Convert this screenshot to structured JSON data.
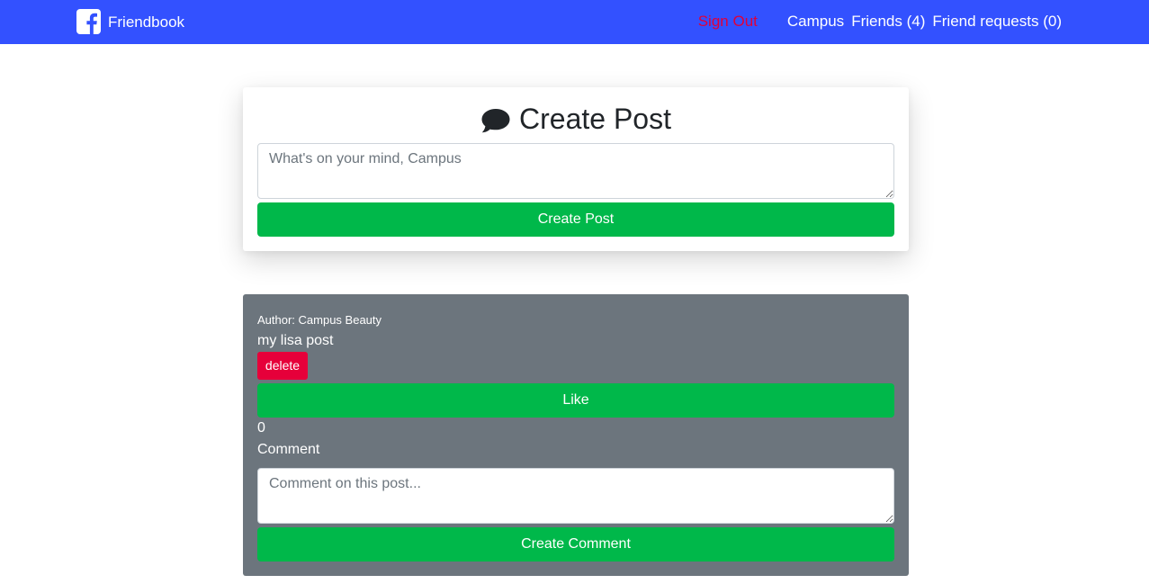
{
  "navbar": {
    "brand_icon": "facebook-logo-icon",
    "brand": "Friendbook",
    "background": "#3351ff",
    "sign_out": "Sign Out",
    "sign_out_color": "#e0003a",
    "user": "Campus",
    "friends": "Friends (4)",
    "friend_requests": "Friend requests (0)"
  },
  "create_post": {
    "icon": "comment-icon",
    "title": "Create Post",
    "placeholder": "What's on your mind, Campus",
    "button": "Create Post"
  },
  "post": {
    "author": "Author: Campus Beauty",
    "text": "my lisa post",
    "delete": "delete",
    "like": "Like",
    "likes": "0",
    "comment_label": "Comment",
    "comment_placeholder": "Comment on this post...",
    "create_comment": "Create Comment"
  },
  "colors": {
    "accent_green": "#00b84a",
    "danger": "#e6003a",
    "post_background": "#6c757d"
  }
}
